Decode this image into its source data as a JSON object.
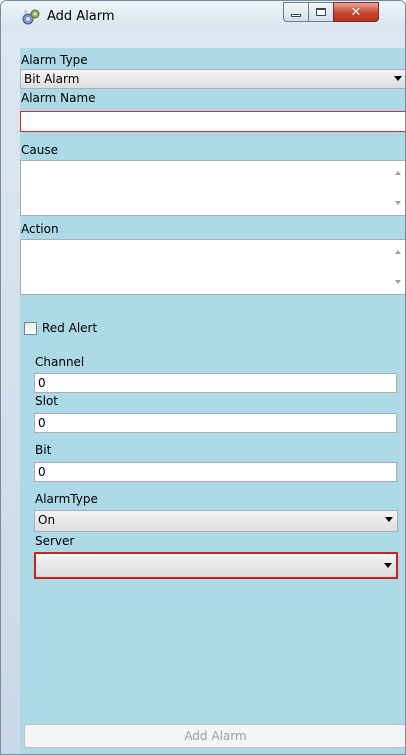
{
  "window": {
    "title": "Add Alarm"
  },
  "form": {
    "alarm_type_label": "Alarm Type",
    "alarm_type_value": "Bit Alarm",
    "alarm_name_label": "Alarm Name",
    "alarm_name_value": "",
    "cause_label": "Cause",
    "cause_value": "",
    "action_label": "Action",
    "action_value": "",
    "red_alert_label": "Red Alert",
    "red_alert_checked": false,
    "channel_label": "Channel",
    "channel_value": "0",
    "slot_label": "Slot",
    "slot_value": "0",
    "bit_label": "Bit",
    "bit_value": "0",
    "alarm_type2_label": "AlarmType",
    "alarm_type2_value": "On",
    "server_label": "Server",
    "server_value": ""
  },
  "buttons": {
    "add_alarm": "Add Alarm"
  },
  "colors": {
    "form_background": "#add8e6",
    "error_border": "#cc2020",
    "disabled_text": "#a0a0a0"
  },
  "icons": [
    "app-gear-icon",
    "minimize-icon",
    "maximize-icon",
    "close-icon",
    "dropdown-arrow-icon",
    "scroll-up-icon",
    "scroll-down-icon"
  ]
}
